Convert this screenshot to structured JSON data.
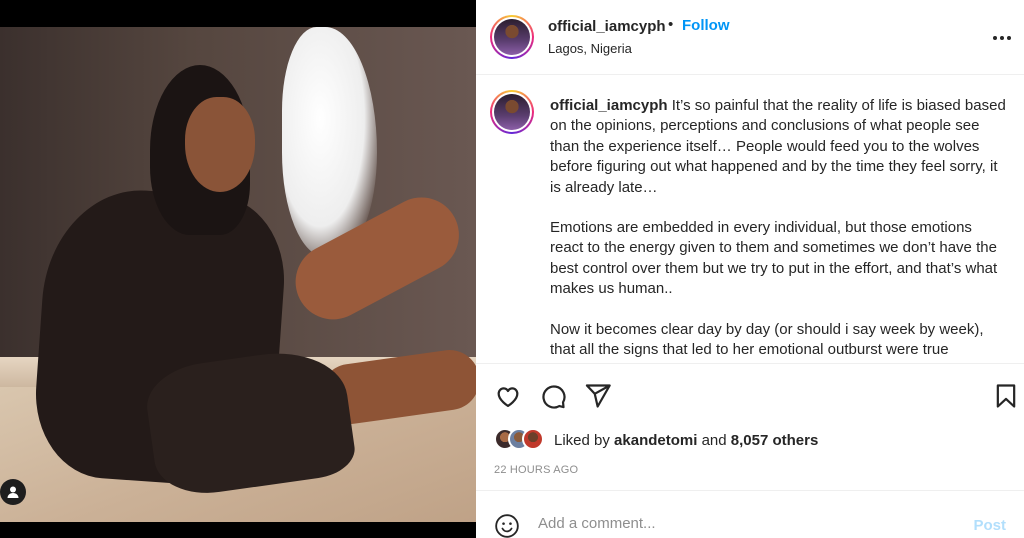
{
  "post": {
    "username": "official_iamcyph",
    "separator": "•",
    "follow_label": "Follow",
    "location": "Lagos, Nigeria",
    "caption": {
      "username": "official_iamcyph",
      "paragraphs": [
        "It’s so painful that the reality of life is biased based on the opinions, perceptions and conclusions of what people see than the experience itself… People would feed you to the wolves before figuring out what happened and by the time they feel sorry, it is already late…",
        "Emotions are embedded in every individual, but those emotions react to the energy given to them and sometimes we don’t have the best control over them but we try to put in the effort, and that’s what makes us human..",
        "Now it becomes clear day by day (or should i say week by week), that all the signs that led to her emotional outburst were true"
      ]
    },
    "likes": {
      "prefix": "Liked by",
      "liker": "akandetomi",
      "conjunction": "and",
      "others": "8,057 others"
    },
    "timestamp": "22 HOURS AGO",
    "comment": {
      "placeholder": "Add a comment...",
      "post_label": "Post"
    }
  },
  "icons": {
    "like": "heart-icon",
    "comment": "comment-bubble-icon",
    "share": "paper-plane-icon",
    "save": "bookmark-icon",
    "more": "more-options-icon",
    "emoji": "smiley-icon",
    "tag": "user-tag-icon"
  },
  "colors": {
    "follow": "#0095f6",
    "post_disabled": "#b2dffc",
    "muted": "#8e8e8e",
    "text": "#262626"
  }
}
